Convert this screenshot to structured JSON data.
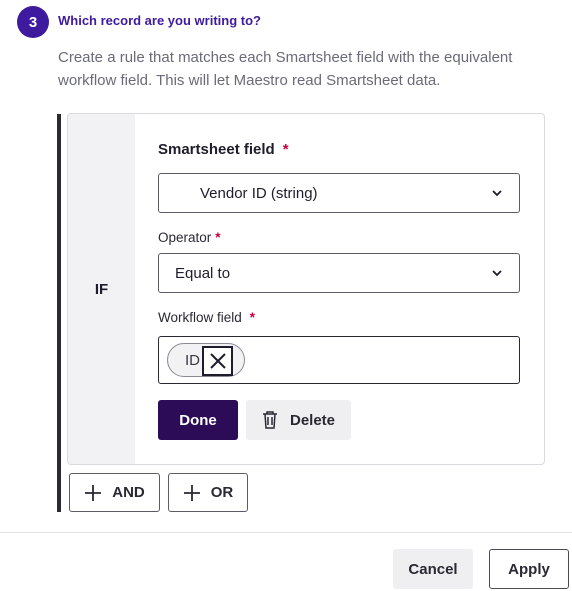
{
  "step": {
    "number": "3",
    "title": "Which record are you writing to?",
    "description": "Create a rule that matches each Smartsheet field with the equivalent workflow field. This will let Maestro read Smartsheet data."
  },
  "rule": {
    "if_label": "IF",
    "smartsheet_field": {
      "label": "Smartsheet field",
      "required": "*",
      "value": "Vendor ID (string)"
    },
    "operator": {
      "label": "Operator",
      "required": "*",
      "value": "Equal to"
    },
    "workflow_field": {
      "label": "Workflow field",
      "required": "*",
      "chip": "ID"
    },
    "done_label": "Done",
    "delete_label": "Delete"
  },
  "logic": {
    "and_label": "AND",
    "or_label": "OR"
  },
  "footer": {
    "cancel_label": "Cancel",
    "apply_label": "Apply"
  },
  "colors": {
    "accent": "#3d1a9e",
    "primary_button": "#2d0c57",
    "required": "#c4003a"
  },
  "icons": [
    "chevron-down-icon",
    "close-icon",
    "trash-icon",
    "plus-icon"
  ]
}
